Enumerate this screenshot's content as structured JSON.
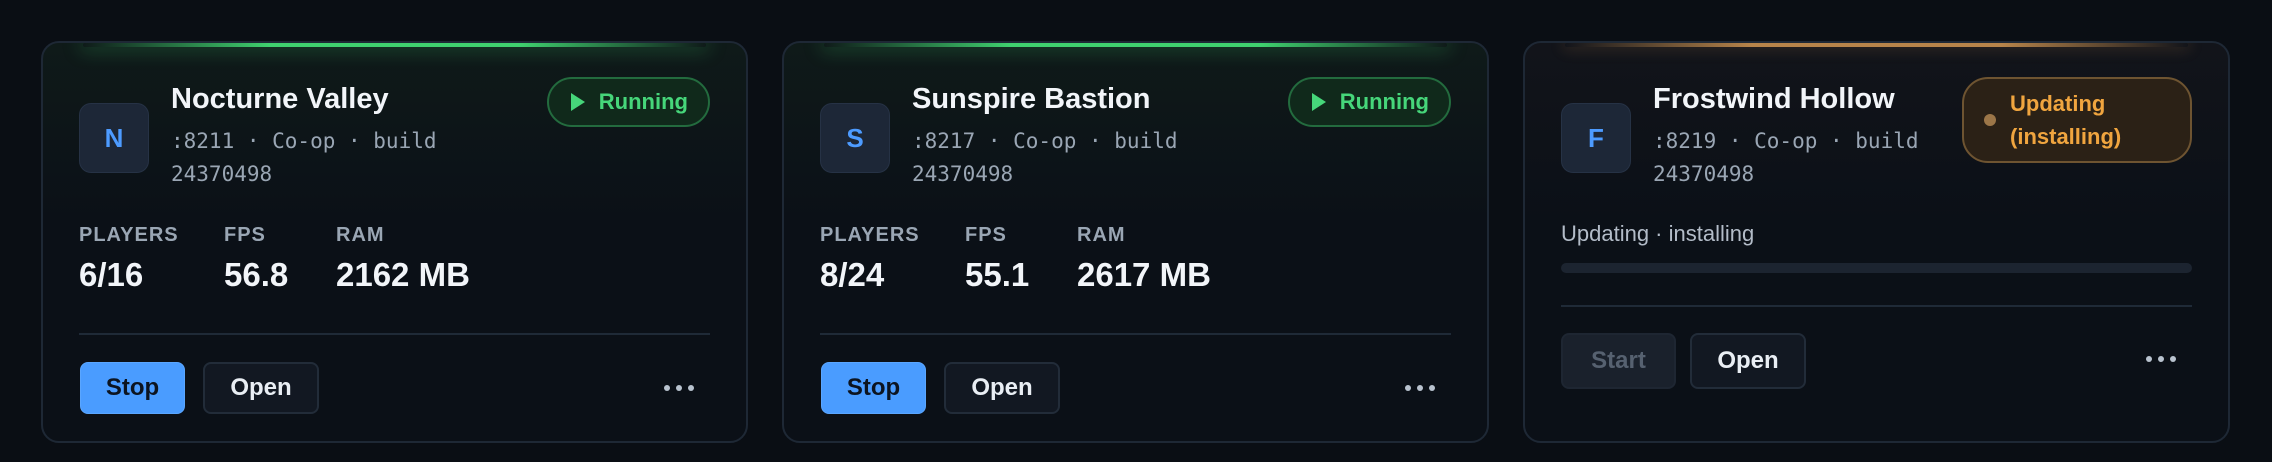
{
  "servers": [
    {
      "initial": "N",
      "name": "Nocturne Valley",
      "meta": ":8211 · Co-op · build 24370498",
      "status": "Running",
      "stats": [
        {
          "label": "PLAYERS",
          "value": "6/16"
        },
        {
          "label": "FPS",
          "value": "56.8"
        },
        {
          "label": "RAM",
          "value": "2162 MB"
        }
      ],
      "primary_action": "Stop",
      "secondary_action": "Open"
    },
    {
      "initial": "S",
      "name": "Sunspire Bastion",
      "meta": ":8217 · Co-op · build 24370498",
      "status": "Running",
      "stats": [
        {
          "label": "PLAYERS",
          "value": "8/24"
        },
        {
          "label": "FPS",
          "value": "55.1"
        },
        {
          "label": "RAM",
          "value": "2617 MB"
        }
      ],
      "primary_action": "Stop",
      "secondary_action": "Open"
    },
    {
      "initial": "F",
      "name": "Frostwind Hollow",
      "meta": ":8219 · Co-op · build 24370498",
      "status": "Updating (installing)",
      "progress_label": "Updating · installing",
      "progress": 0,
      "primary_action": "Start",
      "secondary_action": "Open"
    }
  ],
  "icons": {
    "status_running": "play-icon",
    "status_updating": "dot-icon",
    "menu": "more-icon"
  },
  "colors": {
    "accent": "#4a9cff",
    "running": "#46d67a",
    "updating": "#f0a53f",
    "background": "#0a0e14"
  }
}
